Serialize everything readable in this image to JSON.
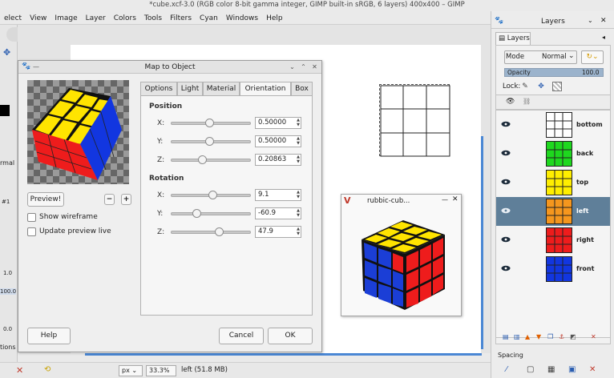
{
  "window": {
    "title": "*cube.xcf-3.0 (RGB color 8-bit gamma integer, GIMP built-in sRGB, 6 layers) 400x400 – GIMP"
  },
  "menu": [
    "elect",
    "View",
    "Image",
    "Layer",
    "Colors",
    "Tools",
    "Filters",
    "Cyan",
    "Windows",
    "Help"
  ],
  "toolbox": {
    "values": [
      "rmal",
      "#1",
      "1.0",
      "100.0",
      "0.0",
      "tions"
    ]
  },
  "dialog": {
    "title": "Map to Object",
    "preview_button": "Preview!",
    "zoom_out": "−",
    "zoom_in": "+",
    "show_wireframe": "Show wireframe",
    "update_preview": "Update preview live",
    "help": "Help",
    "cancel": "Cancel",
    "ok": "OK",
    "tabs": [
      "Options",
      "Light",
      "Material",
      "Orientation",
      "Box"
    ],
    "active_tab": "Orientation",
    "position": {
      "title": "Position",
      "x_label": "X:",
      "x": "0.50000",
      "y_label": "Y:",
      "y": "0.50000",
      "z_label": "Z:",
      "z": "0.20863"
    },
    "rotation": {
      "title": "Rotation",
      "x_label": "X:",
      "x": "9.1",
      "y_label": "Y:",
      "y": "-60.9",
      "z_label": "Z:",
      "z": "47.9"
    }
  },
  "rubbic": {
    "title": "rubbic-cub..."
  },
  "status": {
    "unit": "px",
    "zoom": "33.3%",
    "info": "left (51.8 MB)"
  },
  "layers": {
    "dock_title": "Layers",
    "tab": "Layers",
    "mode_label": "Mode",
    "mode_value": "Normal",
    "opacity_label": "Opacity",
    "opacity_value": "100.0",
    "lock_label": "Lock:",
    "items": [
      {
        "name": "bottom",
        "color": "#ffffff"
      },
      {
        "name": "back",
        "color": "#1ed81e"
      },
      {
        "name": "top",
        "color": "#ffee00"
      },
      {
        "name": "left",
        "color": "#f5961e"
      },
      {
        "name": "right",
        "color": "#ee1c1c"
      },
      {
        "name": "front",
        "color": "#1236e0"
      }
    ],
    "selected": "left",
    "spacing_label": "Spacing"
  }
}
